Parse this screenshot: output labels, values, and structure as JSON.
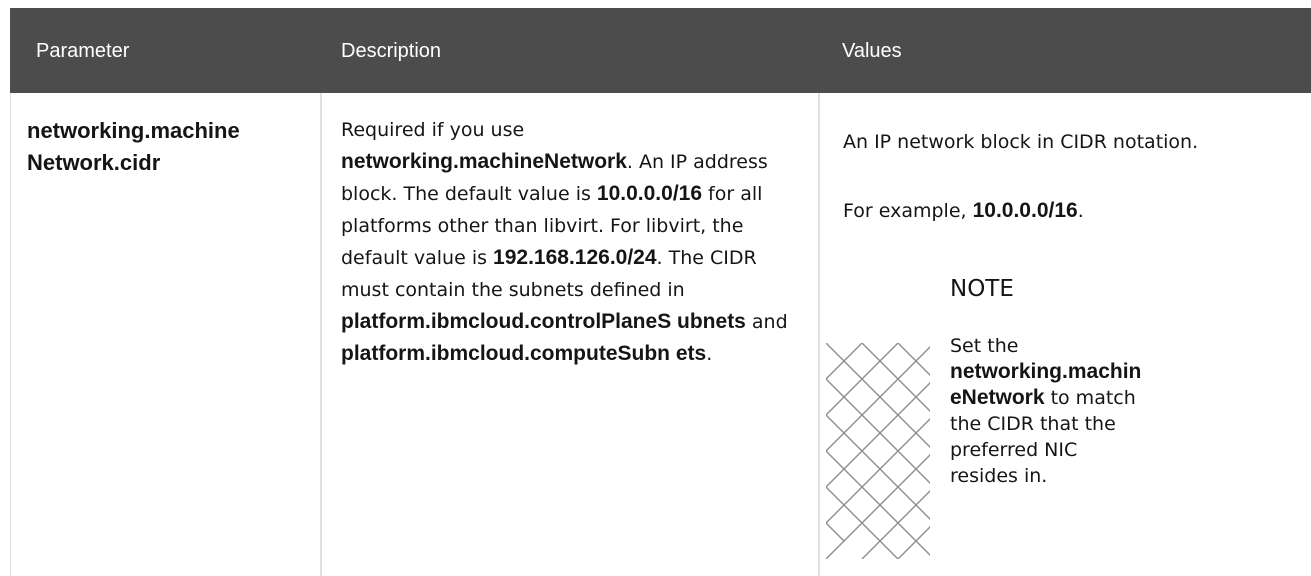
{
  "header": {
    "parameter": "Parameter",
    "description": "Description",
    "values": "Values"
  },
  "row": {
    "parameter_line1": "networking.machine",
    "parameter_line2": "Network.cidr",
    "description": {
      "t1": "Required if you use ",
      "b1": "networking.machineNetwork",
      "t2": ". An IP address block. The default value is ",
      "b2": "10.0.0.0/16",
      "t3": " for all platforms other than libvirt. For libvirt, the default value is ",
      "b3": "192.168.126.0/24",
      "t4": ". The CIDR must contain the subnets defined in ",
      "b4": "platform.ibmcloud.controlPlaneS ubnets",
      "t5": " and ",
      "b5": "platform.ibmcloud.computeSubn ets",
      "t6": "."
    },
    "values": {
      "line1": "An IP network block in CIDR notation.",
      "example_prefix": "For example, ",
      "example_value": "10.0.0.0/16",
      "example_suffix": ".",
      "note": {
        "heading": "NOTE",
        "t1": "Set the ",
        "b1": "networking.machin eNetwork",
        "t2": " to match the CIDR that the preferred NIC resides in."
      }
    }
  }
}
